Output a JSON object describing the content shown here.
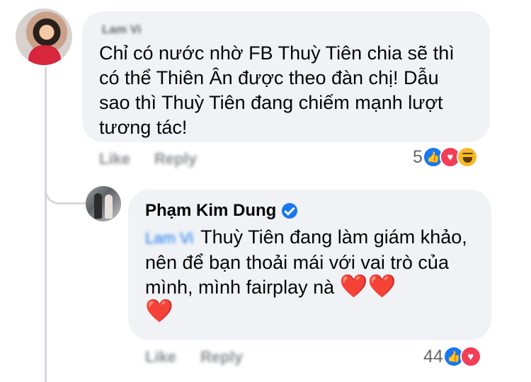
{
  "comment_1": {
    "author": "Lam Vi",
    "text": "Chỉ có nước nhờ FB Thuỳ Tiên chia sẽ thì có thể Thiên Ân được theo đàn chị! Dẫu sao thì Thuỳ Tiên đang chiếm mạnh lượt tương tác!",
    "like_label": "Like",
    "reply_label": "Reply",
    "reaction_count": "5",
    "reactions": [
      "like-icon",
      "love-icon",
      "haha-icon"
    ]
  },
  "comment_2": {
    "author": "Phạm Kim Dung",
    "verified": true,
    "mention": "Lam Vi",
    "text": "Thuỳ Tiên đang làm giám khảo, nên để bạn thoải mái với vai trò của mình, mình fairplay nà",
    "emoji_1": "❤️",
    "emoji_2": "❤️",
    "emoji_3": "❤️",
    "like_label": "Like",
    "reply_label": "Reply",
    "reaction_count": "44",
    "reactions": [
      "like-icon",
      "love-icon"
    ]
  },
  "colors": {
    "bubble": "#f0f2f5",
    "link_blue": "#1877f2",
    "secondary_text": "#65676b",
    "heart": "#e0245e"
  }
}
